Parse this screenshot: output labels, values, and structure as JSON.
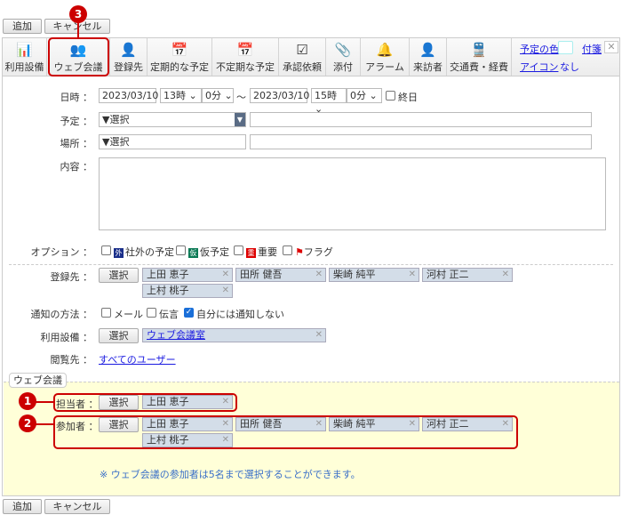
{
  "actions": {
    "add": "追加",
    "cancel": "キャンセル"
  },
  "toolbar": {
    "items": [
      {
        "label": "利用設備",
        "icon": "facility-add-icon"
      },
      {
        "label": "ウェブ会議",
        "icon": "web-meeting-add-icon"
      },
      {
        "label": "登録先",
        "icon": "user-add-icon"
      },
      {
        "label": "定期的な予定",
        "icon": "calendar-icon"
      },
      {
        "label": "不定期な予定",
        "icon": "calendar-irregular-icon"
      },
      {
        "label": "承認依頼",
        "icon": "approval-icon"
      },
      {
        "label": "添付",
        "icon": "paperclip-icon"
      },
      {
        "label": "アラーム",
        "icon": "bell-icon"
      },
      {
        "label": "来訪者",
        "icon": "visitor-icon"
      },
      {
        "label": "交通費・経費",
        "icon": "train-icon"
      }
    ],
    "color_link": "予定の色",
    "sticky_link": "付箋",
    "icon_link": "アイコン",
    "icon_value": "なし"
  },
  "form": {
    "datetime": {
      "label": "日時 ：",
      "start_date": "2023/03/10",
      "start_hour": "13時",
      "start_min": "0分",
      "sep": "～",
      "end_date": "2023/03/10",
      "end_hour": "15時",
      "end_min": "0分",
      "allday": "終日"
    },
    "plan": {
      "label": "予定 ：",
      "select": "▼選択"
    },
    "place": {
      "label": "場所 ：",
      "select": "▼選択"
    },
    "content": {
      "label": "内容 ："
    },
    "options": {
      "label": "オプション ：",
      "items": [
        {
          "badge": "外",
          "text": "社外の予定",
          "color": "#1a2f8a"
        },
        {
          "badge": "仮",
          "text": "仮予定",
          "color": "#0b7a55"
        },
        {
          "badge": "重",
          "text": "重要",
          "color": "#d00"
        },
        {
          "text": "フラグ",
          "color": "#d00"
        }
      ]
    },
    "registrants": {
      "label": "登録先 ：",
      "select": "選択",
      "names": [
        "上田 恵子",
        "田所 健吾",
        "柴崎 純平",
        "河村 正二",
        "上村 桃子"
      ]
    },
    "notify": {
      "label": "通知の方法 ：",
      "mail": "メール",
      "message": "伝言",
      "self": "自分には通知しない",
      "self_checked": true
    },
    "facility": {
      "label": "利用設備 ：",
      "select": "選択",
      "value": "ウェブ会議室"
    },
    "viewers": {
      "label": "閲覧先 ：",
      "value": "すべてのユーザー"
    }
  },
  "web_meeting": {
    "legend": "ウェブ会議",
    "host": {
      "label": "担当者 ：",
      "select": "選択",
      "names": [
        "上田 恵子"
      ]
    },
    "participants": {
      "label": "参加者 ：",
      "select": "選択",
      "names": [
        "上田 恵子",
        "田所 健吾",
        "柴崎 純平",
        "河村 正二",
        "上村 桃子"
      ]
    },
    "note": "※ ウェブ会議の参加者は5名まで選択することができます。"
  },
  "callouts": [
    "1",
    "2",
    "3"
  ]
}
